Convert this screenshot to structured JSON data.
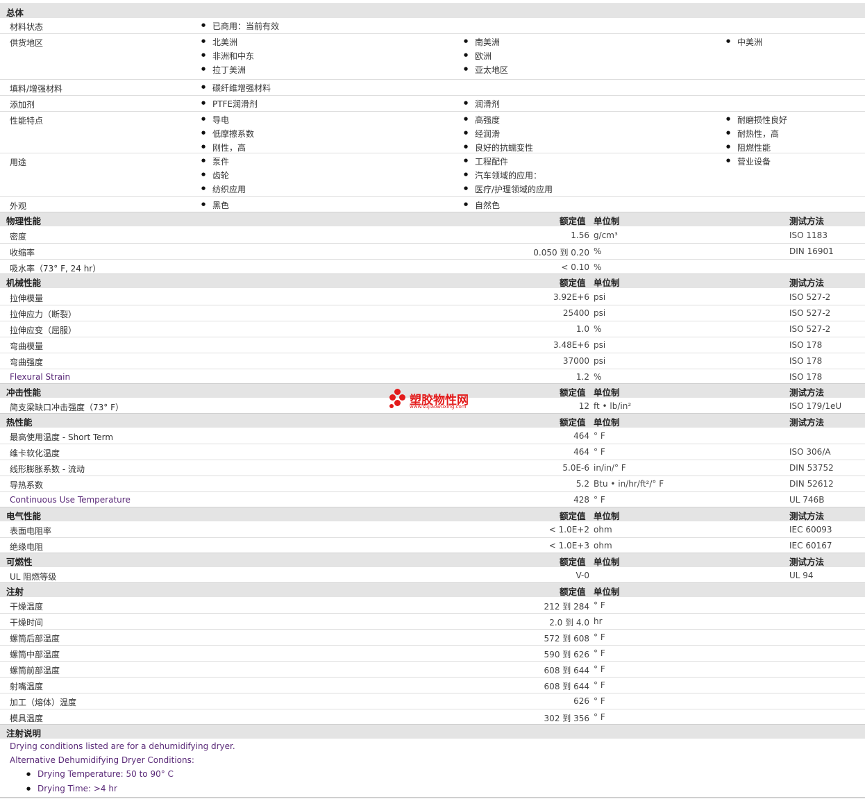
{
  "general": {
    "title": "总体",
    "material_status": {
      "label": "材料状态",
      "value": "已商用：当前有效"
    },
    "supply_region": {
      "label": "供货地区",
      "col1": [
        "北美洲",
        "非洲和中东",
        "拉丁美洲"
      ],
      "col2": [
        "南美洲",
        "欧洲",
        "亚太地区"
      ],
      "col3": [
        "中美洲"
      ]
    },
    "filler": {
      "label": "填料/增强材料",
      "value": "碳纤维增强材料"
    },
    "additive": {
      "label": "添加剂",
      "value1": "PTFE润滑剂",
      "value2": "润滑剂"
    },
    "features": {
      "label": "性能特点",
      "col1": [
        "导电",
        "低摩擦系数",
        "刚性，高"
      ],
      "col2": [
        "高强度",
        "经润滑",
        "良好的抗蠕变性"
      ],
      "col3": [
        "耐磨损性良好",
        "耐热性，高",
        "阻燃性能"
      ]
    },
    "uses": {
      "label": "用途",
      "col1": [
        "泵件",
        "齿轮",
        "纺织应用"
      ],
      "col2": [
        "工程配件",
        "汽车领域的应用：",
        "医疗/护理领域的应用"
      ],
      "col3": [
        "营业设备"
      ]
    },
    "appearance": {
      "label": "外观",
      "value1": "黑色",
      "value2": "自然色"
    }
  },
  "col_headers": {
    "nominal": "额定值",
    "unit": "单位制",
    "test": "测试方法"
  },
  "physical": {
    "title": "物理性能",
    "rows": [
      {
        "label": "密度",
        "value": "1.56",
        "unit": "g/cm³",
        "test": "ISO 1183"
      },
      {
        "label": "收缩率",
        "value": "0.050 到  0.20",
        "unit": "%",
        "test": "DIN 16901"
      },
      {
        "label": "吸水率（73°  F, 24 hr）",
        "value": "< 0.10",
        "unit": "%",
        "test": ""
      }
    ]
  },
  "mechanical": {
    "title": "机械性能",
    "rows": [
      {
        "label": "拉伸模量",
        "value": "3.92E+6",
        "unit": "psi",
        "test": "ISO 527-2"
      },
      {
        "label": "拉伸应力（断裂）",
        "value": "25400",
        "unit": "psi",
        "test": "ISO 527-2"
      },
      {
        "label": "拉伸应变（屈服）",
        "value": "1.0",
        "unit": "%",
        "test": "ISO 527-2"
      },
      {
        "label": "弯曲模量",
        "value": "3.48E+6",
        "unit": "psi",
        "test": "ISO 178"
      },
      {
        "label": "弯曲强度",
        "value": "37000",
        "unit": "psi",
        "test": "ISO 178"
      },
      {
        "label": "Flexural Strain",
        "value": "1.2",
        "unit": "%",
        "test": "ISO 178"
      }
    ]
  },
  "impact": {
    "title": "冲击性能",
    "rows": [
      {
        "label": "简支梁缺口冲击强度（73°  F）",
        "value": "12",
        "unit": "ft • lb/in²",
        "test": "ISO 179/1eU"
      }
    ]
  },
  "thermal": {
    "title": "热性能",
    "rows": [
      {
        "label": "最高使用温度",
        "label_sub": " - Short Term",
        "value": "464",
        "unit": "°  F",
        "test": ""
      },
      {
        "label": "维卡软化温度",
        "value": "464",
        "unit": "°  F",
        "test": "ISO 306/A"
      },
      {
        "label": "线形膨胀系数",
        "label_sub": " - 流动",
        "value": "5.0E-6",
        "unit": "in/in/°  F",
        "test": "DIN 53752"
      },
      {
        "label": "导热系数",
        "value": "5.2",
        "unit": "Btu • in/hr/ft²/°  F",
        "test": "DIN 52612"
      },
      {
        "label": "Continuous Use Temperature",
        "value": "428",
        "unit": "°  F",
        "test": "UL 746B"
      }
    ]
  },
  "electrical": {
    "title": "电气性能",
    "rows": [
      {
        "label": "表面电阻率",
        "value": "< 1.0E+2",
        "unit": "ohm",
        "test": "IEC 60093"
      },
      {
        "label": "绝缘电阻",
        "value": "< 1.0E+3",
        "unit": "ohm",
        "test": "IEC 60167"
      }
    ]
  },
  "flammability": {
    "title": "可燃性",
    "rows": [
      {
        "label": "UL 阻燃等级",
        "value": "V-0",
        "unit": "",
        "test": "UL 94"
      }
    ]
  },
  "injection": {
    "title": "注射",
    "rows": [
      {
        "label": "干燥温度",
        "value": "212 到  284",
        "unit": "°  F"
      },
      {
        "label": "干燥时间",
        "value": "2.0 到  4.0",
        "unit": "hr"
      },
      {
        "label": "螺筒后部温度",
        "value": "572 到  608",
        "unit": "°  F"
      },
      {
        "label": "螺筒中部温度",
        "value": "590 到  626",
        "unit": "°  F"
      },
      {
        "label": "螺筒前部温度",
        "value": "608 到  644",
        "unit": "°  F"
      },
      {
        "label": "射嘴温度",
        "value": "608 到  644",
        "unit": "°  F"
      },
      {
        "label": "加工（熔体）温度",
        "value": "626",
        "unit": "°  F"
      },
      {
        "label": "模具温度",
        "value": "302 到  356",
        "unit": "°  F"
      }
    ]
  },
  "injection_notes": {
    "title": "注射说明",
    "line1": "Drying conditions listed are for a dehumidifying dryer.",
    "line2": "Alternative Dehumidifying Dryer Conditions:",
    "bullets": [
      "Drying Temperature: 50 to 90°  C",
      "Drying Time: >4 hr"
    ]
  },
  "watermark": {
    "text": "塑胶物性网",
    "url": "www.sujiaowuxing.com",
    "color": "#e31b1b"
  },
  "colors": {
    "header_bg": "#e4e4e4",
    "link": "#5a2a78",
    "text": "#333333"
  }
}
